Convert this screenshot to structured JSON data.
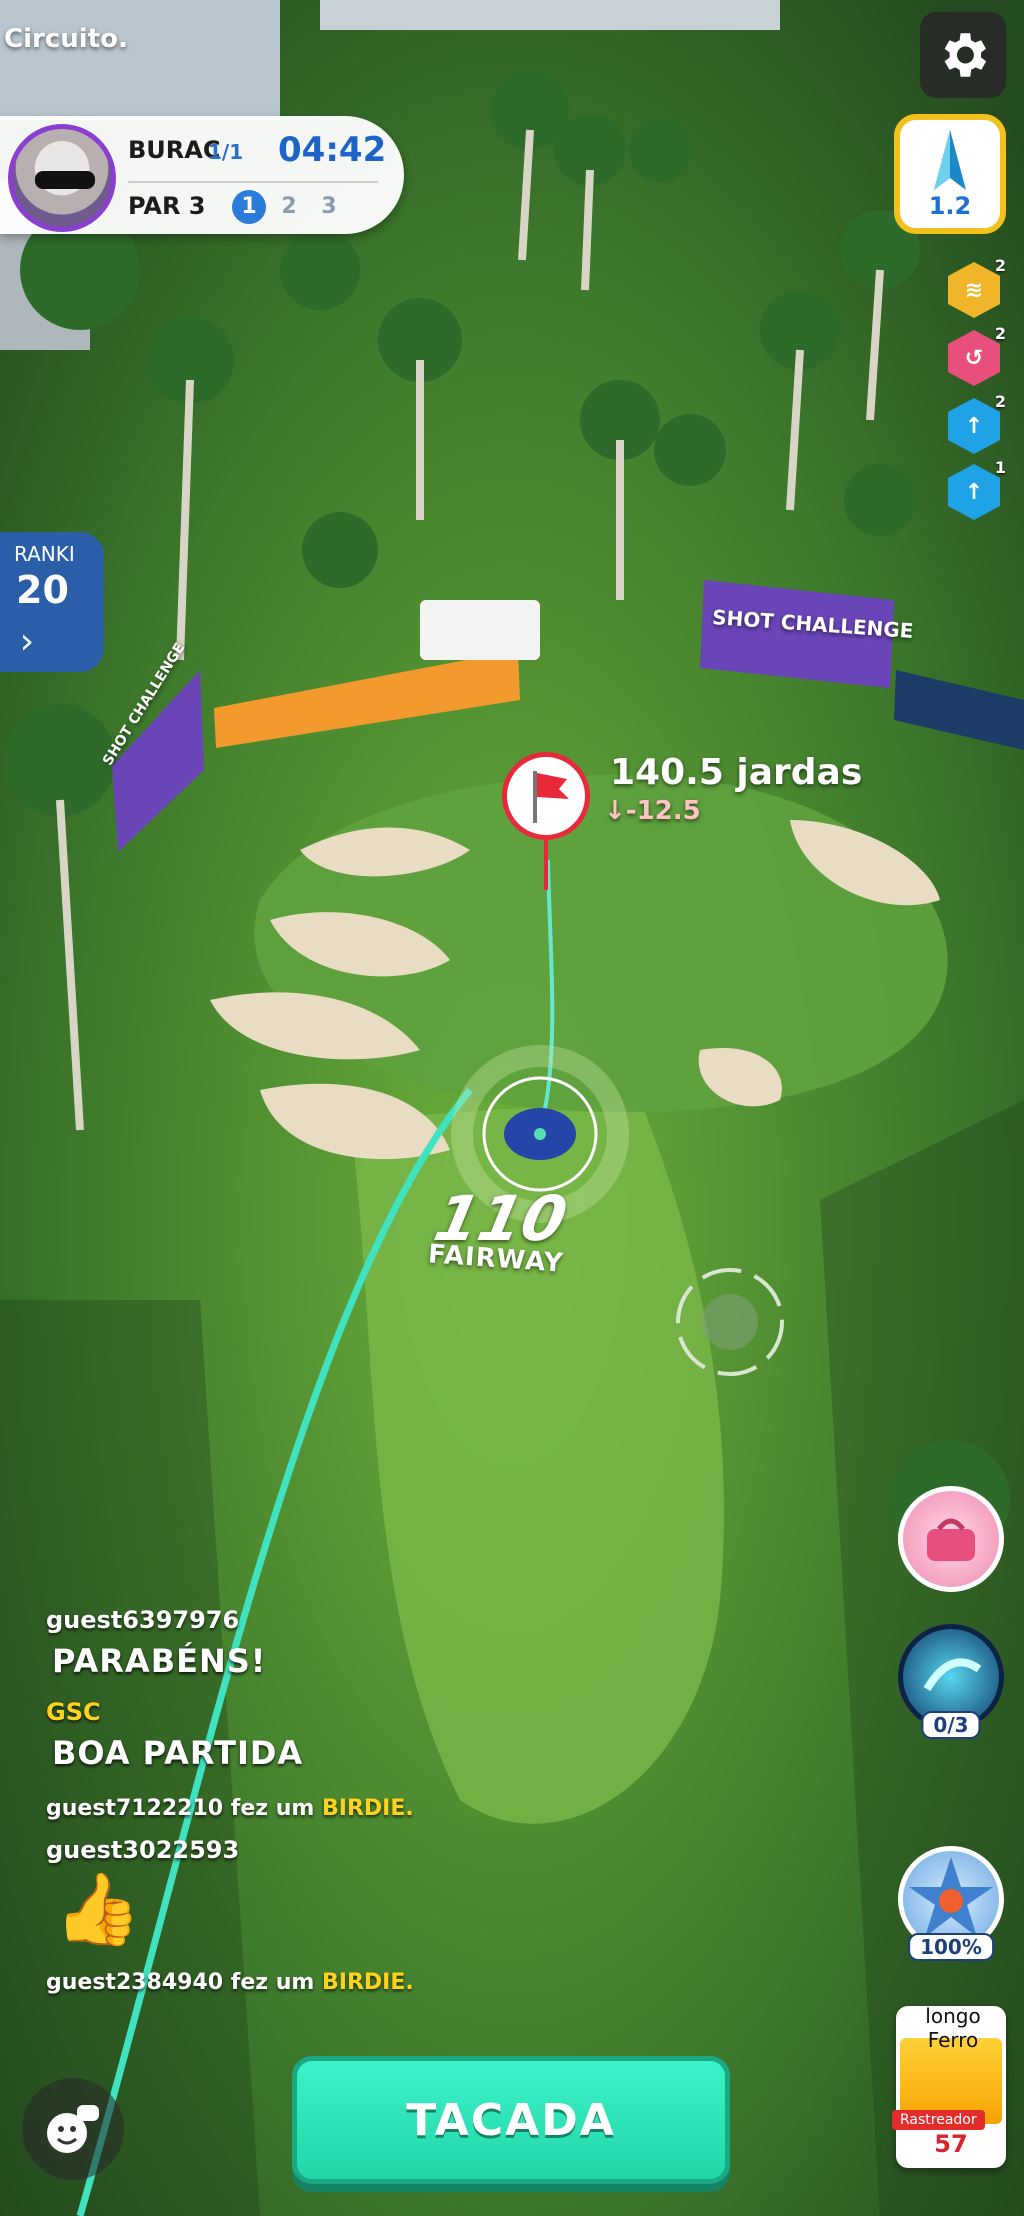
{
  "status": {
    "circuit_text": "Circuito."
  },
  "hole": {
    "name": "BURAC",
    "count": "1/1",
    "timer": "04:42",
    "par": "PAR 3",
    "rounds": [
      "1",
      "2",
      "3"
    ]
  },
  "wind": {
    "value": "1.2"
  },
  "perks": [
    "2",
    "2",
    "2",
    "1"
  ],
  "ranking": {
    "label": "RANKI",
    "value": "20",
    "arrow": "›"
  },
  "target": {
    "distance": "140.5 jardas",
    "elevation": "↓-12.5"
  },
  "shot": {
    "distance": "110",
    "lie": "FAIRWAY"
  },
  "billboards": {
    "shot_challenge": "SHOT CHALLENGE",
    "shot_challenge_side": "SHOT CHALLENGE"
  },
  "chat": [
    {
      "type": "name",
      "text": "guest6397976"
    },
    {
      "type": "big",
      "text": "PARABÉNS!"
    },
    {
      "type": "name_gold",
      "text": "GSC"
    },
    {
      "type": "big",
      "text": "BOA PARTIDA"
    },
    {
      "type": "event",
      "player": "guest7122210",
      "verb": " fez um ",
      "event": "BIRDIE."
    },
    {
      "type": "name",
      "text": "guest3022593"
    },
    {
      "type": "emoji",
      "text": "👍"
    },
    {
      "type": "event",
      "player": "guest2384940",
      "verb": " fez um ",
      "event": "BIRDIE."
    }
  ],
  "items": {
    "special_shot_count": "0/3",
    "power_percent": "100%"
  },
  "club": {
    "name": "longo Ferro",
    "tracker": "Rastreador",
    "count": "57"
  },
  "actions": {
    "shot_button": "TACADA"
  },
  "colors": {
    "accent": "#2ee3b8",
    "brand_blue": "#1e63c9",
    "flag_red": "#e8293a",
    "highlight": "#ffd21f"
  }
}
